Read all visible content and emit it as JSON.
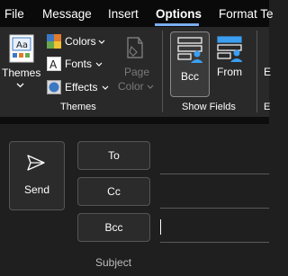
{
  "menu": {
    "tabs": [
      "File",
      "Message",
      "Insert",
      "Options",
      "Format Te"
    ],
    "active_tab": "Options"
  },
  "ribbon": {
    "themes_group": {
      "themes_label": "Themes",
      "colors_label": "Colors",
      "fonts_label": "Fonts",
      "effects_label": "Effects",
      "page_color_line1": "Page",
      "page_color_line2": "Color",
      "group_label": "Themes"
    },
    "show_fields_group": {
      "bcc_label": "Bcc",
      "from_label": "From",
      "group_label": "Show Fields"
    },
    "clipped_group": {
      "partial_label": "E",
      "partial_group_label": "E"
    }
  },
  "compose": {
    "send_label": "Send",
    "to_label": "To",
    "cc_label": "Cc",
    "bcc_label": "Bcc",
    "subject_label": "Subject"
  },
  "colors": {
    "accent": "#7aaef0",
    "background": "#1f1f1f",
    "ribbon_bg": "#292929",
    "menubar_bg": "#0a0a0a"
  }
}
